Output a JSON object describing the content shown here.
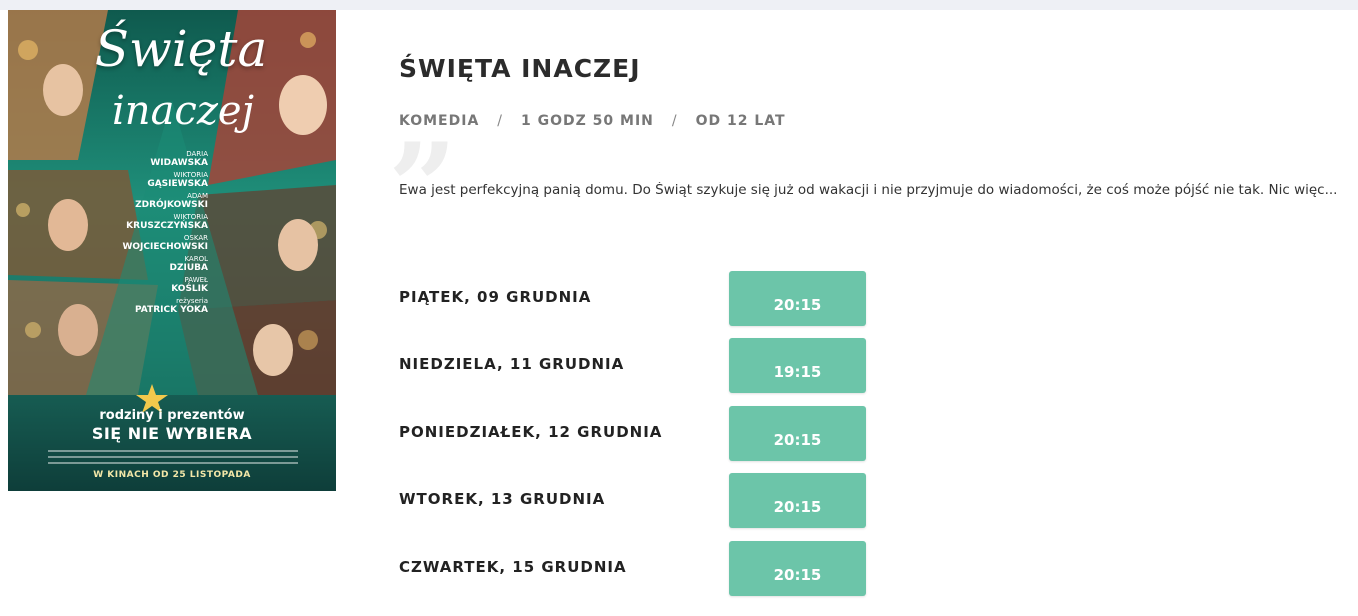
{
  "poster": {
    "title_line1": "Święta",
    "title_line2": "inaczej",
    "cast": [
      {
        "first": "DARIA",
        "last": "WIDAWSKA"
      },
      {
        "first": "WIKTORIA",
        "last": "GĄSIEWSKA"
      },
      {
        "first": "ADAM",
        "last": "ZDRÓJKOWSKI"
      },
      {
        "first": "WIKTORIA",
        "last": "KRUSZCZYŃSKA"
      },
      {
        "first": "OSKAR",
        "last": "WOJCIECHOWSKI"
      },
      {
        "first": "KAROL",
        "last": "DZIUBA"
      },
      {
        "first": "PAWEŁ",
        "last": "KOŚLIK"
      },
      {
        "first": "reżyseria",
        "last": "PATRICK YOKA"
      }
    ],
    "tagline_top": "rodziny i prezentów",
    "tagline_bottom": "SIĘ NIE WYBIERA",
    "release": "W KINACH OD 25 LISTOPADA"
  },
  "movie": {
    "title": "ŚWIĘTA INACZEJ",
    "genre": "KOMEDIA",
    "duration": "1 GODZ 50 MIN",
    "age": "OD 12 LAT",
    "separator": "/",
    "description": "Ewa jest perfekcyjną panią domu. Do Świąt szykuje się już od wakacji i nie przyjmuje do wiadomości, że coś może pójść nie tak. Nic więc..."
  },
  "showtimes": [
    {
      "day": "PIĄTEK, 09 GRUDNIA",
      "time": "20:15"
    },
    {
      "day": "NIEDZIELA, 11 GRUDNIA",
      "time": "19:15"
    },
    {
      "day": "PONIEDZIAŁEK, 12 GRUDNIA",
      "time": "20:15"
    },
    {
      "day": "WTOREK, 13 GRUDNIA",
      "time": "20:15"
    },
    {
      "day": "CZWARTEK, 15 GRUDNIA",
      "time": "20:15"
    }
  ],
  "colors": {
    "accent": "#6cc5a9",
    "title_text": "#2b2b2b",
    "meta_text": "#777777",
    "page_background": "#eef0f5"
  }
}
